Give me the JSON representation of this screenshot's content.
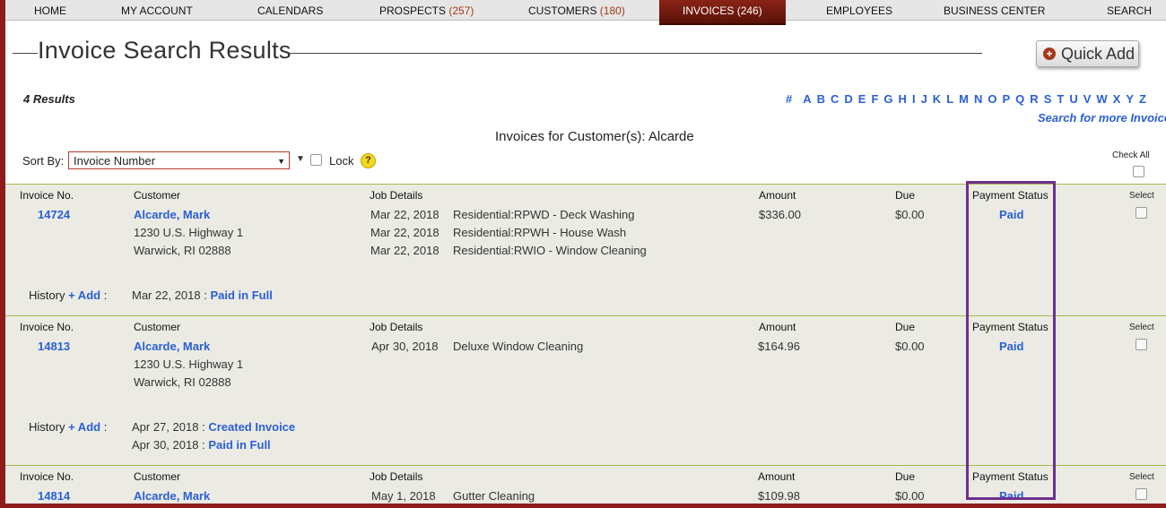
{
  "nav": {
    "home": "HOME",
    "my_account": "MY ACCOUNT",
    "calendars": "CALENDARS",
    "prospects": "PROSPECTS",
    "prospects_count": "(257)",
    "customers": "CUSTOMERS",
    "customers_count": "(180)",
    "invoices": "INVOICES",
    "invoices_count": "(246)",
    "employees": "EMPLOYEES",
    "business_center": "BUSINESS CENTER",
    "search": "SEARCH"
  },
  "page": {
    "title": "Invoice Search Results",
    "quick_add": "Quick Add",
    "results_count": "4 Results",
    "alphabet": [
      "#",
      "A",
      "B",
      "C",
      "D",
      "E",
      "F",
      "G",
      "H",
      "I",
      "J",
      "K",
      "L",
      "M",
      "N",
      "O",
      "P",
      "Q",
      "R",
      "S",
      "T",
      "U",
      "V",
      "W",
      "X",
      "Y",
      "Z"
    ],
    "search_more": "Search for more Invoices",
    "invoices_for": "Invoices for Customer(s): Alcarde"
  },
  "sort": {
    "label": "Sort By:",
    "selected": "Invoice Number",
    "lock_label": "Lock",
    "help": "?"
  },
  "check_all": "Check All",
  "headers": {
    "invoice_no": "Invoice No.",
    "customer": "Customer",
    "job_details": "Job Details",
    "amount": "Amount",
    "due": "Due",
    "payment_status": "Payment Status",
    "select": "Select",
    "history": "History",
    "add": "+ Add",
    "colon": ":"
  },
  "invoices": [
    {
      "number": "14724",
      "customer_name": "Alcarde, Mark",
      "address1": "1230 U.S. Highway 1",
      "address2": "Warwick, RI 02888",
      "jobs": [
        {
          "date": "Mar 22, 2018",
          "desc": "Residential:RPWD - Deck Washing"
        },
        {
          "date": "Mar 22, 2018",
          "desc": "Residential:RPWH - House Wash"
        },
        {
          "date": "Mar 22, 2018",
          "desc": "Residential:RWIO - Window Cleaning"
        }
      ],
      "amount": "$336.00",
      "due": "$0.00",
      "status": "Paid",
      "history": [
        {
          "date": "Mar 22, 2018",
          "sep": ":",
          "event": "Paid in Full"
        }
      ]
    },
    {
      "number": "14813",
      "customer_name": "Alcarde, Mark",
      "address1": "1230 U.S. Highway 1",
      "address2": "Warwick, RI 02888",
      "jobs": [
        {
          "date": "Apr 30, 2018",
          "desc": "Deluxe Window Cleaning"
        }
      ],
      "amount": "$164.96",
      "due": "$0.00",
      "status": "Paid",
      "history": [
        {
          "date": "Apr 27, 2018",
          "sep": ":",
          "event": "Created Invoice"
        },
        {
          "date": "Apr 30, 2018",
          "sep": ":",
          "event": "Paid in Full"
        }
      ]
    },
    {
      "number": "14814",
      "customer_name": "Alcarde, Mark",
      "jobs": [
        {
          "date": "May 1, 2018",
          "desc": "Gutter Cleaning"
        }
      ],
      "amount": "$109.98",
      "due": "$0.00",
      "status": "Paid"
    }
  ],
  "colors": {
    "frame": "#8e1b1b",
    "link": "#2a5fd6",
    "row_bg": "#ebebe4",
    "row_border": "#9fb94c",
    "highlight": "#6d2f8f"
  }
}
